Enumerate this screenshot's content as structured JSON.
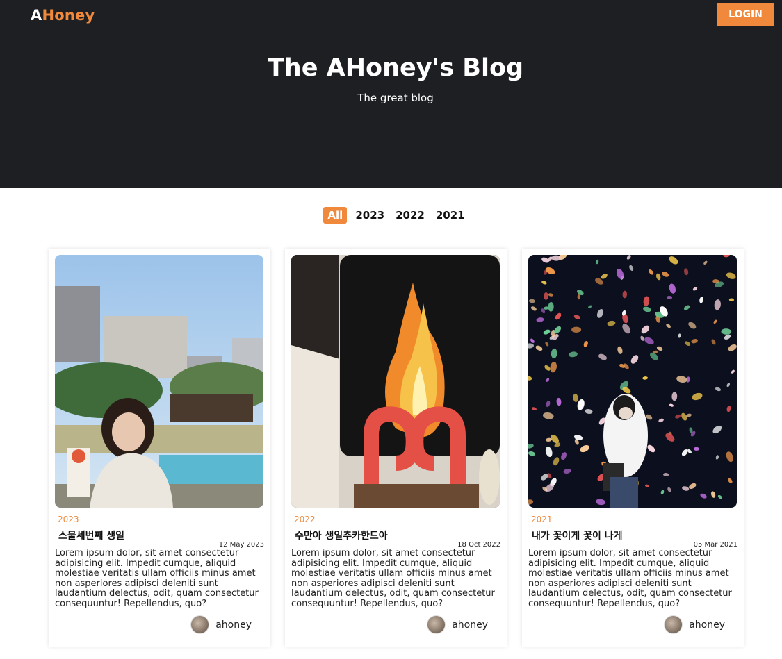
{
  "header": {
    "logo_prefix": "A",
    "logo_suffix": "Honey",
    "login_label": "LOGIN",
    "title": "The AHoney's Blog",
    "subtitle": "The great blog"
  },
  "filters": [
    "All",
    "2023",
    "2022",
    "2021"
  ],
  "colors": {
    "accent": "#f0893c",
    "header_bg": "#1d1f22"
  },
  "posts": [
    {
      "year": "2023",
      "title": "스물세번째 생일",
      "date": "12 May 2023",
      "body": "Lorem ipsum dolor, sit amet consectetur adipisicing elit. Impedit cumque, aliquid molestiae veritatis ullam officiis minus amet non asperiores adipisci deleniti sunt laudantium delectus, odit, quam consectetur consequuntur! Repellendus, quo?",
      "author": "ahoney"
    },
    {
      "year": "2022",
      "title": "수만아 생일추카한드아",
      "date": "18 Oct 2022",
      "body": "Lorem ipsum dolor, sit amet consectetur adipisicing elit. Impedit cumque, aliquid molestiae veritatis ullam officiis minus amet non asperiores adipisci deleniti sunt laudantium delectus, odit, quam consectetur consequuntur! Repellendus, quo?",
      "author": "ahoney"
    },
    {
      "year": "2021",
      "title": "내가 꽃이게 꽃이 나게",
      "date": "05 Mar 2021",
      "body": "Lorem ipsum dolor, sit amet consectetur adipisicing elit. Impedit cumque, aliquid molestiae veritatis ullam officiis minus amet non asperiores adipisci deleniti sunt laudantium delectus, odit, quam consectetur consequuntur! Repellendus, quo?",
      "author": "ahoney"
    }
  ]
}
